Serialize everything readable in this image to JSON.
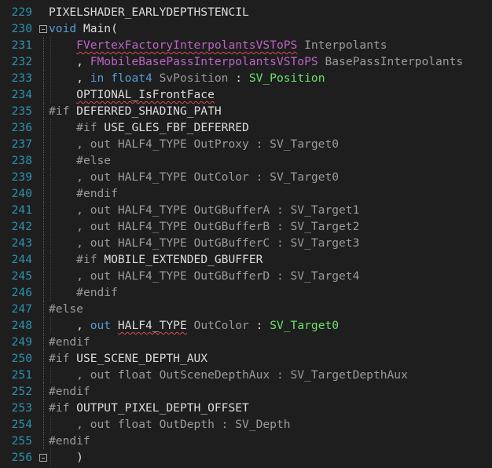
{
  "editor": {
    "lines": [
      {
        "num": "229",
        "tokens": [
          {
            "t": "PIXELSHADER_EARLYDEPTHSTENCIL",
            "c": "plain"
          }
        ]
      },
      {
        "num": "230",
        "fold": true,
        "tokens": [
          {
            "t": "void",
            "c": "kw"
          },
          {
            "t": " Main(",
            "c": "plain"
          }
        ]
      },
      {
        "num": "231",
        "tokens": [
          {
            "t": "    ",
            "c": "plain"
          },
          {
            "t": "FVertexFactoryInterpolantsVSToPS",
            "c": "macro_squig"
          },
          {
            "t": " Interpolants",
            "c": "param"
          }
        ]
      },
      {
        "num": "232",
        "tokens": [
          {
            "t": "    , ",
            "c": "plain"
          },
          {
            "t": "FMobileBasePassInterpolantsVSToPS",
            "c": "macro"
          },
          {
            "t": " BasePassInterpolants",
            "c": "param"
          }
        ]
      },
      {
        "num": "233",
        "tokens": [
          {
            "t": "    , ",
            "c": "plain"
          },
          {
            "t": "in",
            "c": "kw"
          },
          {
            "t": " ",
            "c": "plain"
          },
          {
            "t": "float4",
            "c": "kw"
          },
          {
            "t": " SvPosition ",
            "c": "param"
          },
          {
            "t": ": ",
            "c": "plain"
          },
          {
            "t": "SV_Position",
            "c": "sem2"
          }
        ]
      },
      {
        "num": "234",
        "tokens": [
          {
            "t": "    ",
            "c": "plain"
          },
          {
            "t": "OPTIONAL_IsFrontFace",
            "c": "plain_squig"
          }
        ]
      },
      {
        "num": "235",
        "tokens": [
          {
            "t": "#if ",
            "c": "pp"
          },
          {
            "t": "DEFERRED_SHADING_PATH",
            "c": "plain"
          }
        ]
      },
      {
        "num": "236",
        "tokens": [
          {
            "t": "    ",
            "c": "plain"
          },
          {
            "t": "#if ",
            "c": "pp"
          },
          {
            "t": "USE_GLES_FBF_DEFERRED",
            "c": "plain"
          }
        ]
      },
      {
        "num": "237",
        "tokens": [
          {
            "t": "    , ",
            "c": "dim"
          },
          {
            "t": "out HALF4_TYPE OutProxy : SV_Target0",
            "c": "dim"
          }
        ]
      },
      {
        "num": "238",
        "tokens": [
          {
            "t": "    ",
            "c": "plain"
          },
          {
            "t": "#else",
            "c": "pp"
          }
        ]
      },
      {
        "num": "239",
        "tokens": [
          {
            "t": "    , ",
            "c": "dim"
          },
          {
            "t": "out HALF4_TYPE OutColor : SV_Target0",
            "c": "dim"
          }
        ]
      },
      {
        "num": "240",
        "tokens": [
          {
            "t": "    ",
            "c": "plain"
          },
          {
            "t": "#endif",
            "c": "pp"
          }
        ]
      },
      {
        "num": "241",
        "tokens": [
          {
            "t": "    , ",
            "c": "dim"
          },
          {
            "t": "out HALF4_TYPE OutGBufferA : SV_Target1",
            "c": "dim"
          }
        ]
      },
      {
        "num": "242",
        "tokens": [
          {
            "t": "    , ",
            "c": "dim"
          },
          {
            "t": "out HALF4_TYPE OutGBufferB : SV_Target2",
            "c": "dim"
          }
        ]
      },
      {
        "num": "243",
        "tokens": [
          {
            "t": "    , ",
            "c": "dim"
          },
          {
            "t": "out HALF4_TYPE OutGBufferC : SV_Target3",
            "c": "dim"
          }
        ]
      },
      {
        "num": "244",
        "tokens": [
          {
            "t": "    ",
            "c": "plain"
          },
          {
            "t": "#if ",
            "c": "pp"
          },
          {
            "t": "MOBILE_EXTENDED_GBUFFER",
            "c": "plain"
          }
        ]
      },
      {
        "num": "245",
        "tokens": [
          {
            "t": "    , ",
            "c": "dim"
          },
          {
            "t": "out HALF4_TYPE OutGBufferD : SV_Target4",
            "c": "dim"
          }
        ]
      },
      {
        "num": "246",
        "tokens": [
          {
            "t": "    ",
            "c": "plain"
          },
          {
            "t": "#endif",
            "c": "pp"
          }
        ]
      },
      {
        "num": "247",
        "tokens": [
          {
            "t": "#else",
            "c": "pp"
          }
        ]
      },
      {
        "num": "248",
        "tokens": [
          {
            "t": "    , ",
            "c": "plain"
          },
          {
            "t": "out",
            "c": "kw"
          },
          {
            "t": " ",
            "c": "plain"
          },
          {
            "t": "HALF4_TYPE",
            "c": "plain_squig"
          },
          {
            "t": " OutColor ",
            "c": "param"
          },
          {
            "t": ": ",
            "c": "plain"
          },
          {
            "t": "SV_Target0",
            "c": "sem2"
          }
        ]
      },
      {
        "num": "249",
        "tokens": [
          {
            "t": "#endif",
            "c": "pp"
          }
        ]
      },
      {
        "num": "250",
        "tokens": [
          {
            "t": "#if ",
            "c": "pp"
          },
          {
            "t": "USE_SCENE_DEPTH_AUX",
            "c": "plain"
          }
        ]
      },
      {
        "num": "251",
        "tokens": [
          {
            "t": "    , ",
            "c": "dim"
          },
          {
            "t": "out float OutSceneDepthAux : SV_TargetDepthAux",
            "c": "dim"
          }
        ]
      },
      {
        "num": "252",
        "tokens": [
          {
            "t": "#endif",
            "c": "pp"
          }
        ]
      },
      {
        "num": "253",
        "tokens": [
          {
            "t": "#if ",
            "c": "pp"
          },
          {
            "t": "OUTPUT_PIXEL_DEPTH_OFFSET",
            "c": "plain"
          }
        ]
      },
      {
        "num": "254",
        "tokens": [
          {
            "t": "    , ",
            "c": "dim"
          },
          {
            "t": "out float OutDepth : SV_Depth",
            "c": "dim"
          }
        ]
      },
      {
        "num": "255",
        "tokens": [
          {
            "t": "#endif",
            "c": "pp"
          }
        ]
      },
      {
        "num": "256",
        "fold": true,
        "tokens": [
          {
            "t": "    )",
            "c": "plain"
          }
        ]
      }
    ]
  }
}
